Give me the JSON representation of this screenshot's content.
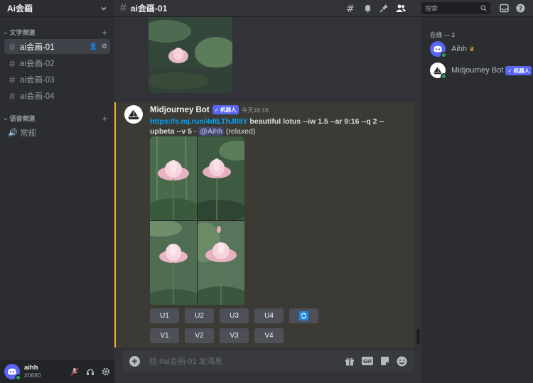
{
  "server": {
    "name": "Ai会画"
  },
  "categories": [
    {
      "label": "文字频道"
    },
    {
      "label": "语音频道"
    }
  ],
  "text_channels": [
    {
      "name": "ai会画-01"
    },
    {
      "name": "ai会画-02"
    },
    {
      "name": "ai会画-03"
    },
    {
      "name": "ai会画-04"
    }
  ],
  "voice_channels": [
    {
      "name": "常规"
    }
  ],
  "topbar": {
    "channel": "ai会画-01",
    "search_placeholder": "搜索"
  },
  "message": {
    "author": "Midjourney Bot",
    "badge": "✓ 机器人",
    "timestamp": "今天18:16",
    "link": "https://s.mj.run/4dtLThJlI8Y",
    "prompt": "beautiful lotus --iw 1.5 --ar 9:16 --q 2 --upbeta --v 5",
    "separator": " - ",
    "mention": "@Aihh",
    "mode": "(relaxed)"
  },
  "buttons": {
    "upscale": [
      "U1",
      "U2",
      "U3",
      "U4"
    ],
    "variation": [
      "V1",
      "V2",
      "V3",
      "V4"
    ]
  },
  "input": {
    "placeholder": "给 #ai会画-01 发消息"
  },
  "members": {
    "header": "在线 — 2",
    "list": [
      {
        "name": "Aihh"
      },
      {
        "name": "Midjourney Bot",
        "badge": "✓ 机器人"
      }
    ]
  },
  "user": {
    "name": "aihh",
    "tag": "#0680"
  },
  "colors": {
    "accent": "#5865f2",
    "online": "#23a55a",
    "highlight_border": "#f0b232",
    "link": "#00a8fc"
  }
}
